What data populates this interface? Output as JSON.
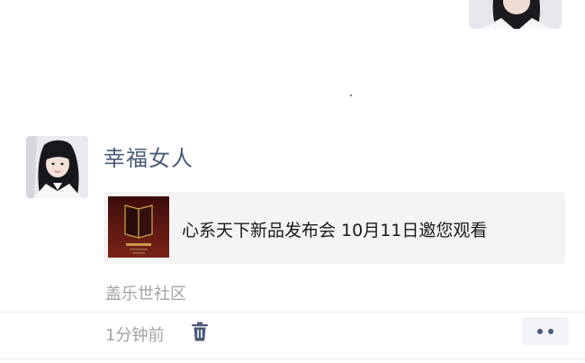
{
  "post": {
    "author_name": "幸福女人",
    "link_card": {
      "title": "心系天下新品发布会 10月11日邀您观看"
    },
    "source": "盖乐世社区",
    "time": "1分钟前"
  },
  "icons": {
    "delete": "trash-icon",
    "more": "more-dots-icon"
  },
  "colors": {
    "author_name": "#4a5b7a",
    "meta_text": "#a3a3a3",
    "card_background": "#f4f4f5",
    "icon_accent": "#4b5b79"
  }
}
